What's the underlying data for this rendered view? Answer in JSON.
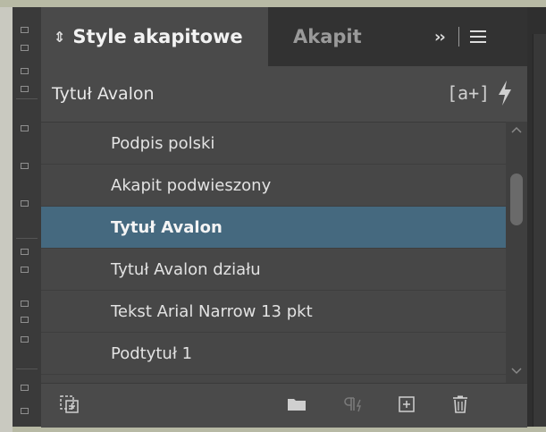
{
  "panel": {
    "tabs": [
      {
        "label": "Style akapitowe",
        "active": true
      },
      {
        "label": "Akapit",
        "active": false
      }
    ],
    "current_style": "Tytuł Avalon",
    "styles": [
      {
        "label": "Podpis polski",
        "selected": false
      },
      {
        "label": "Akapit podwieszony",
        "selected": false
      },
      {
        "label": "Tytuł Avalon",
        "selected": true
      },
      {
        "label": "Tytuł Avalon działu",
        "selected": false
      },
      {
        "label": "Tekst Arial Narrow 13 pkt",
        "selected": false
      },
      {
        "label": "Podtytuł 1",
        "selected": false
      }
    ],
    "icons": {
      "tab_arrows": "updown-arrows-icon",
      "overflow": "double-chevron-right-icon",
      "menu": "hamburger-menu-icon",
      "new_style_from_selection": "new-style-bracket-icon",
      "clear_overrides": "lightning-icon",
      "footer": [
        "load-styles-icon",
        "new-group-folder-icon",
        "clear-overrides-paragraph-icon",
        "create-new-style-icon",
        "delete-trash-icon"
      ]
    },
    "colors": {
      "panel_bg": "#4a4a4a",
      "tabbar_bg": "#323232",
      "selected_row": "#45697f",
      "text": "#e2e2e2"
    }
  }
}
